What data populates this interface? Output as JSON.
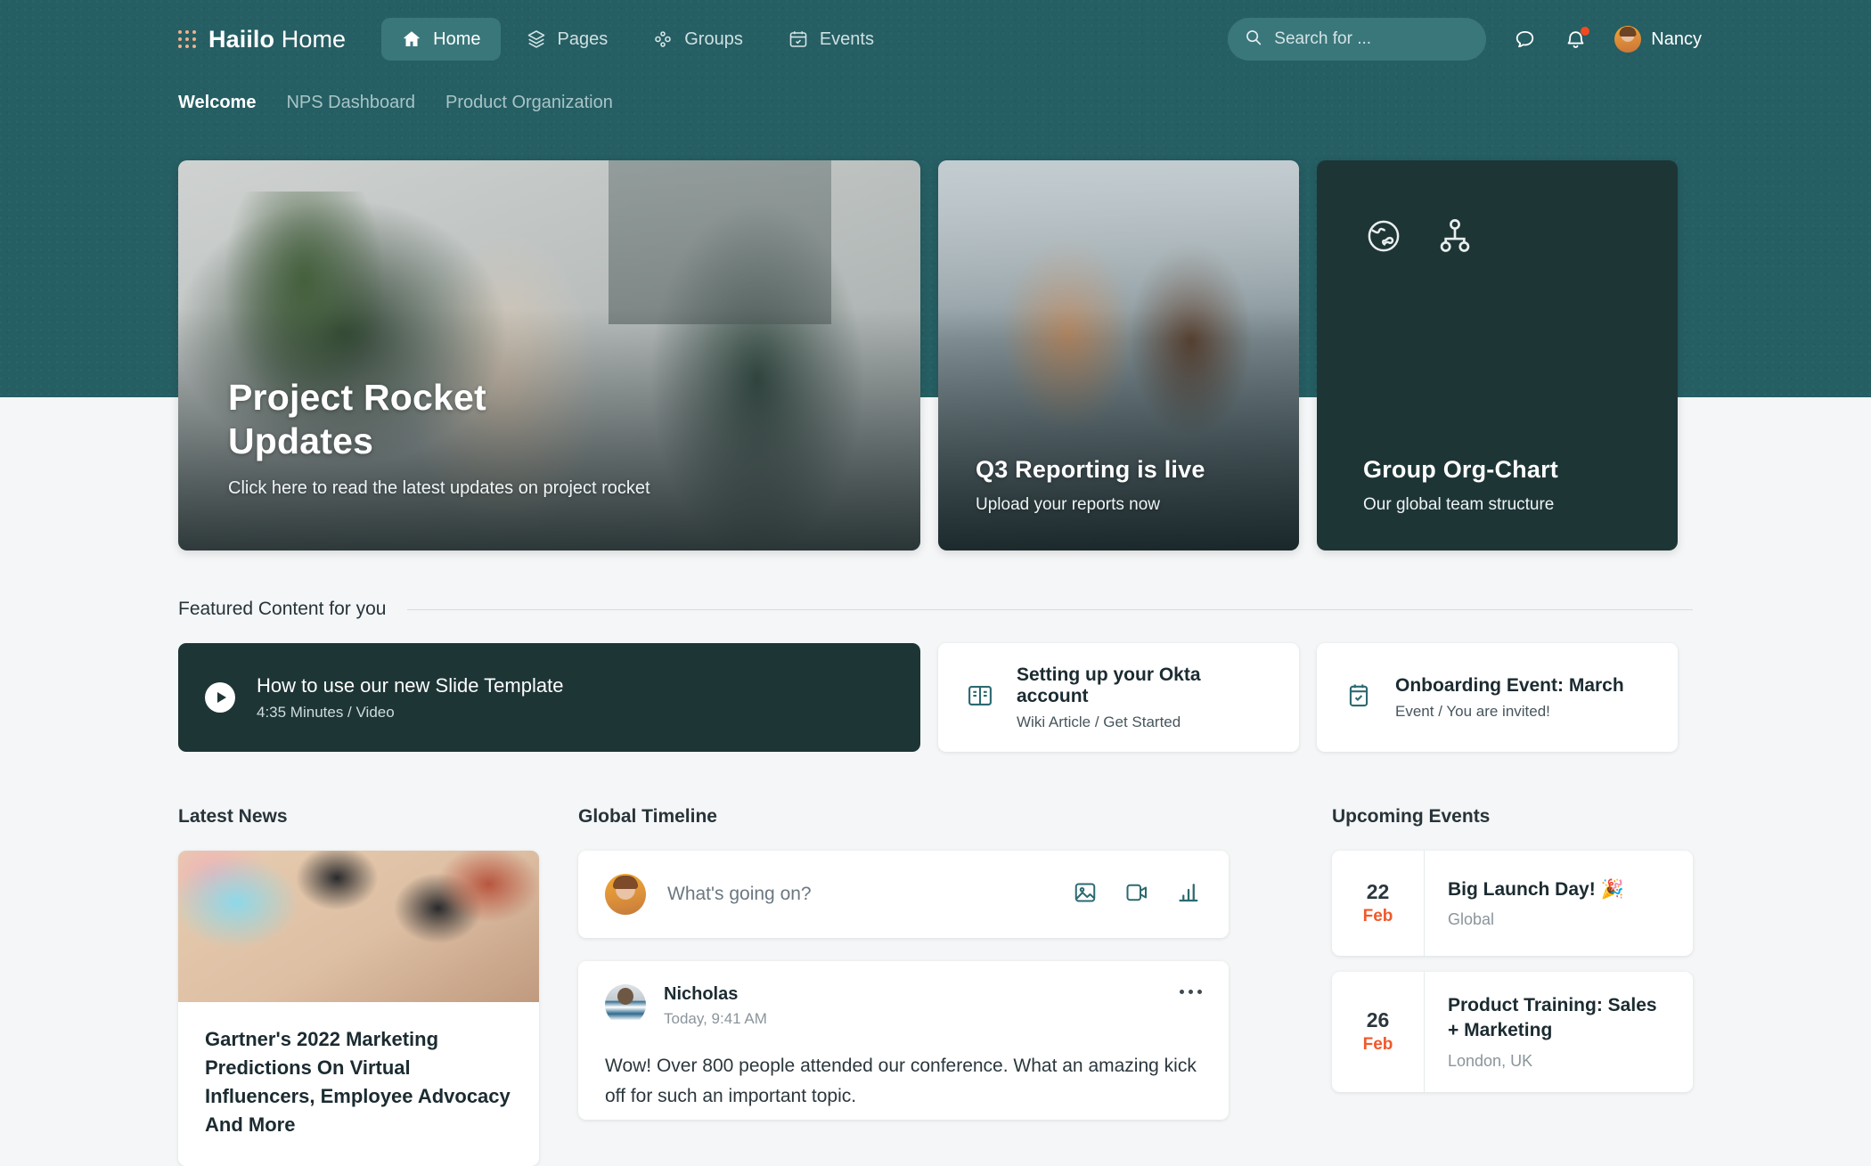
{
  "brand": {
    "name_bold": "Haiilo",
    "name_light": "Home",
    "logo_icon": "dots-grid-icon"
  },
  "nav": {
    "items": [
      {
        "label": "Home",
        "icon": "home-icon",
        "active": true
      },
      {
        "label": "Pages",
        "icon": "layers-icon",
        "active": false
      },
      {
        "label": "Groups",
        "icon": "groups-icon",
        "active": false
      },
      {
        "label": "Events",
        "icon": "calendar-icon",
        "active": false
      }
    ],
    "search": {
      "placeholder": "Search for ...",
      "value": "",
      "icon": "search-icon"
    },
    "chat_icon": "chat-bubble-icon",
    "bell_icon": "bell-icon",
    "bell_has_badge": true,
    "user": {
      "name": "Nancy",
      "avatar": "user-avatar"
    }
  },
  "subnav": {
    "items": [
      {
        "label": "Welcome",
        "active": true
      },
      {
        "label": "NPS Dashboard",
        "active": false
      },
      {
        "label": "Product Organization",
        "active": false
      }
    ]
  },
  "hero": {
    "big": {
      "title": "Project Rocket\nUpdates",
      "title_line1": "Project Rocket",
      "title_line2": "Updates",
      "subtitle": "Click here to read the latest updates on project rocket"
    },
    "mid": {
      "title": "Q3 Reporting is live",
      "subtitle": "Upload your reports now"
    },
    "dark": {
      "title": "Group Org-Chart",
      "subtitle": "Our global team structure",
      "icon_left": "globe-icon",
      "icon_right": "org-chart-icon"
    }
  },
  "featured": {
    "heading": "Featured Content for you",
    "cards": [
      {
        "title": "How to use our new Slide Template",
        "meta": "4:35 Minutes / Video",
        "icon": "play-icon",
        "theme": "dark"
      },
      {
        "title": "Setting up your Okta account",
        "meta": "Wiki Article / Get Started",
        "icon": "book-icon",
        "theme": "light"
      },
      {
        "title": "Onboarding Event: March",
        "meta": "Event / You are invited!",
        "icon": "calendar-check-icon",
        "theme": "light"
      }
    ]
  },
  "news": {
    "heading": "Latest News",
    "article": {
      "title": "Gartner's 2022 Marketing Predictions On Virtual Influencers, Employee Advocacy And More",
      "image": "meeting-table-photo"
    }
  },
  "timeline": {
    "heading": "Global Timeline",
    "composer": {
      "placeholder": "What's going on?",
      "value": "",
      "actions": [
        {
          "icon": "image-icon",
          "name": "add-image"
        },
        {
          "icon": "video-icon",
          "name": "add-video"
        },
        {
          "icon": "poll-icon",
          "name": "add-poll"
        }
      ]
    },
    "posts": [
      {
        "author": "Nicholas",
        "time": "Today, 9:41 AM",
        "body": "Wow! Over 800 people attended our conference. What an amazing kick off for such an important topic.",
        "menu_icon": "more-horizontal-icon"
      }
    ]
  },
  "events": {
    "heading": "Upcoming Events",
    "items": [
      {
        "day": "22",
        "month": "Feb",
        "title": "Big Launch Day! 🎉",
        "location": "Global"
      },
      {
        "day": "26",
        "month": "Feb",
        "title": "Product Training: Sales + Marketing",
        "location": "London, UK"
      }
    ]
  },
  "colors": {
    "header_teal": "#255e63",
    "nav_active": "#3a777b",
    "dark_card": "#1e3536",
    "page_bg": "#f4f6f7",
    "accent_orange": "#f0592a",
    "icon_teal": "#2b6a70"
  }
}
